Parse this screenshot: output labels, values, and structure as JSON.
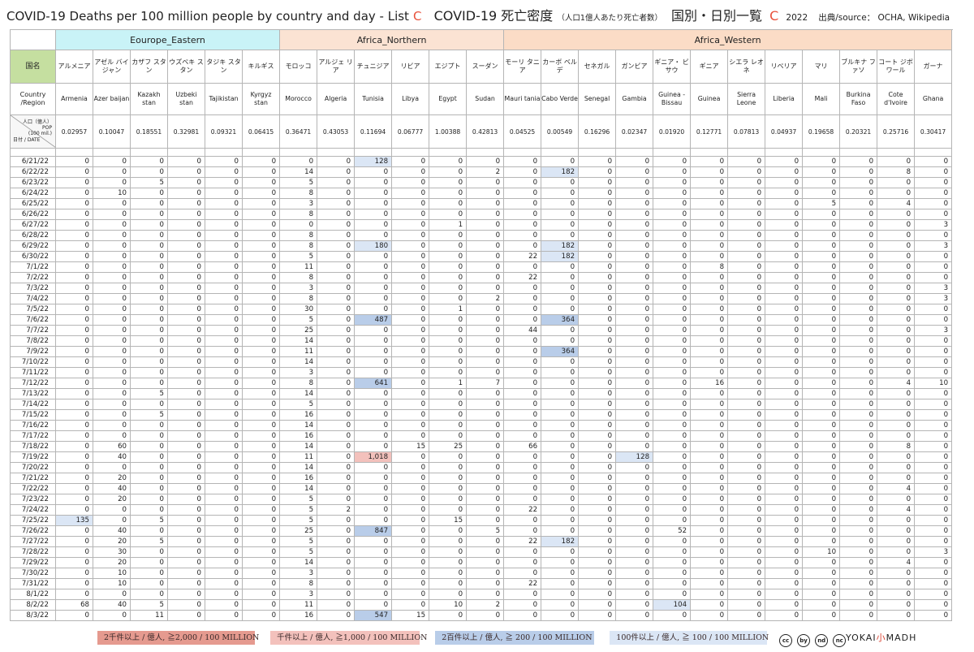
{
  "title": {
    "en": "COVID-19 Deaths per 100 million people by country and day - List",
    "en_letter": "C",
    "jp_main": "COVID-19 死亡密度",
    "jp_sub": "（人口1億人あたり死亡者数）",
    "jp_list": "国別・日別一覧",
    "jp_letter": "C",
    "year": "2022",
    "source": "出典/source： OCHA, Wikipedia"
  },
  "header_labels": {
    "jp": "国名",
    "en": "Country /Region",
    "pop_a": "人口（億人）",
    "pop_b": "POP",
    "pop_c": "(100 mil.)",
    "pop_date": "日付 / DATE"
  },
  "regions": [
    {
      "name": "Eourope_Eastern",
      "span": 6
    },
    {
      "name": "Africa_Northern",
      "span": 6
    },
    {
      "name": "Africa_Western",
      "span": 13
    }
  ],
  "countries": [
    {
      "jp": "アルメニア",
      "en": "Armenia",
      "pop": "0.02957"
    },
    {
      "jp": "アゼル バイジャン",
      "en": "Azer baijan",
      "pop": "0.10047"
    },
    {
      "jp": "カザフ スタン",
      "en": "Kazakh stan",
      "pop": "0.18551"
    },
    {
      "jp": "ウズベキ スタン",
      "en": "Uzbeki stan",
      "pop": "0.32981"
    },
    {
      "jp": "タジキ スタン",
      "en": "Tajikistan",
      "pop": "0.09321"
    },
    {
      "jp": "キルギス",
      "en": "Kyrgyz stan",
      "pop": "0.06415"
    },
    {
      "jp": "モロッコ",
      "en": "Morocco",
      "pop": "0.36471"
    },
    {
      "jp": "アルジェ リア",
      "en": "Algeria",
      "pop": "0.43053"
    },
    {
      "jp": "チュニジア",
      "en": "Tunisia",
      "pop": "0.11694"
    },
    {
      "jp": "リビア",
      "en": "Libya",
      "pop": "0.06777"
    },
    {
      "jp": "エジプト",
      "en": "Egypt",
      "pop": "1.00388"
    },
    {
      "jp": "スーダン",
      "en": "Sudan",
      "pop": "0.42813"
    },
    {
      "jp": "モーリ タニア",
      "en": "Mauri tania",
      "pop": "0.04525"
    },
    {
      "jp": "カーボ ベルデ",
      "en": "Cabo Verde",
      "pop": "0.00549"
    },
    {
      "jp": "セネガル",
      "en": "Senegal",
      "pop": "0.16296"
    },
    {
      "jp": "ガンビア",
      "en": "Gambia",
      "pop": "0.02347"
    },
    {
      "jp": "ギニア・ ビサウ",
      "en": "Guinea -Bissau",
      "pop": "0.01920"
    },
    {
      "jp": "ギニア",
      "en": "Guinea",
      "pop": "0.12771"
    },
    {
      "jp": "シエラ レオネ",
      "en": "Sierra Leone",
      "pop": "0.07813"
    },
    {
      "jp": "リベリア",
      "en": "Liberia",
      "pop": "0.04937"
    },
    {
      "jp": "マリ",
      "en": "Mali",
      "pop": "0.19658"
    },
    {
      "jp": "ブルキナ ファソ",
      "en": "Burkina Faso",
      "pop": "0.20321"
    },
    {
      "jp": "コート ジボワール",
      "en": "Cote d'Ivoire",
      "pop": "0.25716"
    },
    {
      "jp": "ガーナ",
      "en": "Ghana",
      "pop": "0.30417"
    }
  ],
  "rows": [
    {
      "date": "6/21/22",
      "v": [
        "0",
        "0",
        "0",
        "0",
        "0",
        "0",
        "0",
        "0",
        "128",
        "0",
        "0",
        "0",
        "0",
        "0",
        "0",
        "0",
        "0",
        "0",
        "0",
        "0",
        "0",
        "0",
        "0",
        "0"
      ]
    },
    {
      "date": "6/22/22",
      "v": [
        "0",
        "0",
        "0",
        "0",
        "0",
        "0",
        "14",
        "0",
        "0",
        "0",
        "0",
        "2",
        "0",
        "182",
        "0",
        "0",
        "0",
        "0",
        "0",
        "0",
        "0",
        "0",
        "8",
        "0"
      ]
    },
    {
      "date": "6/23/22",
      "v": [
        "0",
        "0",
        "5",
        "0",
        "0",
        "0",
        "5",
        "0",
        "0",
        "0",
        "0",
        "0",
        "0",
        "0",
        "0",
        "0",
        "0",
        "0",
        "0",
        "0",
        "0",
        "0",
        "0",
        "0"
      ]
    },
    {
      "date": "6/24/22",
      "v": [
        "0",
        "10",
        "0",
        "0",
        "0",
        "0",
        "8",
        "0",
        "0",
        "0",
        "0",
        "0",
        "0",
        "0",
        "0",
        "0",
        "0",
        "0",
        "0",
        "0",
        "0",
        "0",
        "0",
        "0"
      ]
    },
    {
      "date": "6/25/22",
      "v": [
        "0",
        "0",
        "0",
        "0",
        "0",
        "0",
        "3",
        "0",
        "0",
        "0",
        "0",
        "0",
        "0",
        "0",
        "0",
        "0",
        "0",
        "0",
        "0",
        "0",
        "5",
        "0",
        "4",
        "0"
      ]
    },
    {
      "date": "6/26/22",
      "v": [
        "0",
        "0",
        "0",
        "0",
        "0",
        "0",
        "8",
        "0",
        "0",
        "0",
        "0",
        "0",
        "0",
        "0",
        "0",
        "0",
        "0",
        "0",
        "0",
        "0",
        "0",
        "0",
        "0",
        "0"
      ]
    },
    {
      "date": "6/27/22",
      "v": [
        "0",
        "0",
        "0",
        "0",
        "0",
        "0",
        "0",
        "0",
        "0",
        "0",
        "1",
        "0",
        "0",
        "0",
        "0",
        "0",
        "0",
        "0",
        "0",
        "0",
        "0",
        "0",
        "0",
        "3"
      ]
    },
    {
      "date": "6/28/22",
      "v": [
        "0",
        "0",
        "0",
        "0",
        "0",
        "0",
        "8",
        "0",
        "0",
        "0",
        "0",
        "0",
        "0",
        "0",
        "0",
        "0",
        "0",
        "0",
        "0",
        "0",
        "0",
        "0",
        "0",
        "0"
      ]
    },
    {
      "date": "6/29/22",
      "v": [
        "0",
        "0",
        "0",
        "0",
        "0",
        "0",
        "8",
        "0",
        "180",
        "0",
        "0",
        "0",
        "0",
        "182",
        "0",
        "0",
        "0",
        "0",
        "0",
        "0",
        "0",
        "0",
        "0",
        "3"
      ]
    },
    {
      "date": "6/30/22",
      "v": [
        "0",
        "0",
        "0",
        "0",
        "0",
        "0",
        "5",
        "0",
        "0",
        "0",
        "0",
        "0",
        "22",
        "182",
        "0",
        "0",
        "0",
        "0",
        "0",
        "0",
        "0",
        "0",
        "0",
        "0"
      ]
    },
    {
      "date": "7/1/22",
      "v": [
        "0",
        "0",
        "0",
        "0",
        "0",
        "0",
        "11",
        "0",
        "0",
        "0",
        "0",
        "0",
        "0",
        "0",
        "0",
        "0",
        "0",
        "8",
        "0",
        "0",
        "0",
        "0",
        "0",
        "0"
      ]
    },
    {
      "date": "7/2/22",
      "v": [
        "0",
        "0",
        "0",
        "0",
        "0",
        "0",
        "8",
        "0",
        "0",
        "0",
        "0",
        "0",
        "22",
        "0",
        "0",
        "0",
        "0",
        "0",
        "0",
        "0",
        "0",
        "0",
        "0",
        "0"
      ]
    },
    {
      "date": "7/3/22",
      "v": [
        "0",
        "0",
        "0",
        "0",
        "0",
        "0",
        "3",
        "0",
        "0",
        "0",
        "0",
        "0",
        "0",
        "0",
        "0",
        "0",
        "0",
        "0",
        "0",
        "0",
        "0",
        "0",
        "0",
        "3"
      ]
    },
    {
      "date": "7/4/22",
      "v": [
        "0",
        "0",
        "0",
        "0",
        "0",
        "0",
        "8",
        "0",
        "0",
        "0",
        "0",
        "2",
        "0",
        "0",
        "0",
        "0",
        "0",
        "0",
        "0",
        "0",
        "0",
        "0",
        "0",
        "3"
      ]
    },
    {
      "date": "7/5/22",
      "v": [
        "0",
        "0",
        "0",
        "0",
        "0",
        "0",
        "30",
        "0",
        "0",
        "0",
        "1",
        "0",
        "0",
        "0",
        "0",
        "0",
        "0",
        "0",
        "0",
        "0",
        "0",
        "0",
        "0",
        "0"
      ]
    },
    {
      "date": "7/6/22",
      "v": [
        "0",
        "0",
        "0",
        "0",
        "0",
        "0",
        "5",
        "0",
        "487",
        "0",
        "0",
        "0",
        "0",
        "364",
        "0",
        "0",
        "0",
        "0",
        "0",
        "0",
        "0",
        "0",
        "0",
        "0"
      ]
    },
    {
      "date": "7/7/22",
      "v": [
        "0",
        "0",
        "0",
        "0",
        "0",
        "0",
        "25",
        "0",
        "0",
        "0",
        "0",
        "0",
        "44",
        "0",
        "0",
        "0",
        "0",
        "0",
        "0",
        "0",
        "0",
        "0",
        "0",
        "3"
      ]
    },
    {
      "date": "7/8/22",
      "v": [
        "0",
        "0",
        "0",
        "0",
        "0",
        "0",
        "14",
        "0",
        "0",
        "0",
        "0",
        "0",
        "0",
        "0",
        "0",
        "0",
        "0",
        "0",
        "0",
        "0",
        "0",
        "0",
        "0",
        "0"
      ]
    },
    {
      "date": "7/9/22",
      "v": [
        "0",
        "0",
        "0",
        "0",
        "0",
        "0",
        "11",
        "0",
        "0",
        "0",
        "0",
        "0",
        "0",
        "364",
        "0",
        "0",
        "0",
        "0",
        "0",
        "0",
        "0",
        "0",
        "0",
        "0"
      ]
    },
    {
      "date": "7/10/22",
      "v": [
        "0",
        "0",
        "0",
        "0",
        "0",
        "0",
        "14",
        "0",
        "0",
        "0",
        "0",
        "0",
        "0",
        "0",
        "0",
        "0",
        "0",
        "0",
        "0",
        "0",
        "0",
        "0",
        "0",
        "0"
      ]
    },
    {
      "date": "7/11/22",
      "v": [
        "0",
        "0",
        "0",
        "0",
        "0",
        "0",
        "3",
        "0",
        "0",
        "0",
        "0",
        "0",
        "0",
        "0",
        "0",
        "0",
        "0",
        "0",
        "0",
        "0",
        "0",
        "0",
        "0",
        "0"
      ]
    },
    {
      "date": "7/12/22",
      "v": [
        "0",
        "0",
        "0",
        "0",
        "0",
        "0",
        "8",
        "0",
        "641",
        "0",
        "1",
        "7",
        "0",
        "0",
        "0",
        "0",
        "0",
        "16",
        "0",
        "0",
        "0",
        "0",
        "4",
        "10"
      ]
    },
    {
      "date": "7/13/22",
      "v": [
        "0",
        "0",
        "5",
        "0",
        "0",
        "0",
        "14",
        "0",
        "0",
        "0",
        "0",
        "0",
        "0",
        "0",
        "0",
        "0",
        "0",
        "0",
        "0",
        "0",
        "0",
        "0",
        "0",
        "0"
      ]
    },
    {
      "date": "7/14/22",
      "v": [
        "0",
        "0",
        "0",
        "0",
        "0",
        "0",
        "5",
        "0",
        "0",
        "0",
        "0",
        "0",
        "0",
        "0",
        "0",
        "0",
        "0",
        "0",
        "0",
        "0",
        "0",
        "0",
        "0",
        "0"
      ]
    },
    {
      "date": "7/15/22",
      "v": [
        "0",
        "0",
        "5",
        "0",
        "0",
        "0",
        "16",
        "0",
        "0",
        "0",
        "0",
        "0",
        "0",
        "0",
        "0",
        "0",
        "0",
        "0",
        "0",
        "0",
        "0",
        "0",
        "0",
        "0"
      ]
    },
    {
      "date": "7/16/22",
      "v": [
        "0",
        "0",
        "0",
        "0",
        "0",
        "0",
        "14",
        "0",
        "0",
        "0",
        "0",
        "0",
        "0",
        "0",
        "0",
        "0",
        "0",
        "0",
        "0",
        "0",
        "0",
        "0",
        "0",
        "0"
      ]
    },
    {
      "date": "7/17/22",
      "v": [
        "0",
        "0",
        "0",
        "0",
        "0",
        "0",
        "16",
        "0",
        "0",
        "0",
        "0",
        "0",
        "0",
        "0",
        "0",
        "0",
        "0",
        "0",
        "0",
        "0",
        "0",
        "0",
        "0",
        "0"
      ]
    },
    {
      "date": "7/18/22",
      "v": [
        "0",
        "60",
        "0",
        "0",
        "0",
        "0",
        "14",
        "0",
        "0",
        "15",
        "25",
        "0",
        "66",
        "0",
        "0",
        "0",
        "0",
        "0",
        "0",
        "0",
        "0",
        "0",
        "8",
        "0"
      ]
    },
    {
      "date": "7/19/22",
      "v": [
        "0",
        "40",
        "0",
        "0",
        "0",
        "0",
        "11",
        "0",
        "1,018",
        "0",
        "0",
        "0",
        "0",
        "0",
        "0",
        "128",
        "0",
        "0",
        "0",
        "0",
        "0",
        "0",
        "0",
        "0"
      ]
    },
    {
      "date": "7/20/22",
      "v": [
        "0",
        "0",
        "0",
        "0",
        "0",
        "0",
        "14",
        "0",
        "0",
        "0",
        "0",
        "0",
        "0",
        "0",
        "0",
        "0",
        "0",
        "0",
        "0",
        "0",
        "0",
        "0",
        "0",
        "0"
      ]
    },
    {
      "date": "7/21/22",
      "v": [
        "0",
        "20",
        "0",
        "0",
        "0",
        "0",
        "16",
        "0",
        "0",
        "0",
        "0",
        "0",
        "0",
        "0",
        "0",
        "0",
        "0",
        "0",
        "0",
        "0",
        "0",
        "0",
        "0",
        "0"
      ]
    },
    {
      "date": "7/22/22",
      "v": [
        "0",
        "40",
        "0",
        "0",
        "0",
        "0",
        "14",
        "0",
        "0",
        "0",
        "0",
        "0",
        "0",
        "0",
        "0",
        "0",
        "0",
        "0",
        "0",
        "0",
        "0",
        "0",
        "4",
        "0"
      ]
    },
    {
      "date": "7/23/22",
      "v": [
        "0",
        "20",
        "0",
        "0",
        "0",
        "0",
        "5",
        "0",
        "0",
        "0",
        "0",
        "0",
        "0",
        "0",
        "0",
        "0",
        "0",
        "0",
        "0",
        "0",
        "0",
        "0",
        "0",
        "0"
      ]
    },
    {
      "date": "7/24/22",
      "v": [
        "0",
        "0",
        "0",
        "0",
        "0",
        "0",
        "5",
        "2",
        "0",
        "0",
        "0",
        "0",
        "22",
        "0",
        "0",
        "0",
        "0",
        "0",
        "0",
        "0",
        "0",
        "0",
        "4",
        "0"
      ]
    },
    {
      "date": "7/25/22",
      "v": [
        "135",
        "0",
        "5",
        "0",
        "0",
        "0",
        "5",
        "0",
        "0",
        "0",
        "15",
        "0",
        "0",
        "0",
        "0",
        "0",
        "0",
        "0",
        "0",
        "0",
        "0",
        "0",
        "0",
        "0"
      ]
    },
    {
      "date": "7/26/22",
      "v": [
        "0",
        "40",
        "0",
        "0",
        "0",
        "0",
        "25",
        "0",
        "847",
        "0",
        "0",
        "5",
        "0",
        "0",
        "0",
        "0",
        "52",
        "0",
        "0",
        "0",
        "0",
        "0",
        "0",
        "0"
      ]
    },
    {
      "date": "7/27/22",
      "v": [
        "0",
        "20",
        "5",
        "0",
        "0",
        "0",
        "5",
        "0",
        "0",
        "0",
        "0",
        "0",
        "22",
        "182",
        "0",
        "0",
        "0",
        "0",
        "0",
        "0",
        "0",
        "0",
        "0",
        "0"
      ]
    },
    {
      "date": "7/28/22",
      "v": [
        "0",
        "30",
        "0",
        "0",
        "0",
        "0",
        "5",
        "0",
        "0",
        "0",
        "0",
        "0",
        "0",
        "0",
        "0",
        "0",
        "0",
        "0",
        "0",
        "0",
        "10",
        "0",
        "0",
        "3"
      ]
    },
    {
      "date": "7/29/22",
      "v": [
        "0",
        "20",
        "0",
        "0",
        "0",
        "0",
        "14",
        "0",
        "0",
        "0",
        "0",
        "0",
        "0",
        "0",
        "0",
        "0",
        "0",
        "0",
        "0",
        "0",
        "0",
        "0",
        "4",
        "0"
      ]
    },
    {
      "date": "7/30/22",
      "v": [
        "0",
        "10",
        "0",
        "0",
        "0",
        "0",
        "3",
        "0",
        "0",
        "0",
        "0",
        "0",
        "0",
        "0",
        "0",
        "0",
        "0",
        "0",
        "0",
        "0",
        "0",
        "0",
        "0",
        "0"
      ]
    },
    {
      "date": "7/31/22",
      "v": [
        "0",
        "10",
        "0",
        "0",
        "0",
        "0",
        "8",
        "0",
        "0",
        "0",
        "0",
        "0",
        "22",
        "0",
        "0",
        "0",
        "0",
        "0",
        "0",
        "0",
        "0",
        "0",
        "0",
        "0"
      ]
    },
    {
      "date": "8/1/22",
      "v": [
        "0",
        "0",
        "0",
        "0",
        "0",
        "0",
        "3",
        "0",
        "0",
        "0",
        "0",
        "0",
        "0",
        "0",
        "0",
        "0",
        "0",
        "0",
        "0",
        "0",
        "0",
        "0",
        "0",
        "0"
      ]
    },
    {
      "date": "8/2/22",
      "v": [
        "68",
        "40",
        "5",
        "0",
        "0",
        "0",
        "11",
        "0",
        "0",
        "0",
        "10",
        "2",
        "0",
        "0",
        "0",
        "0",
        "104",
        "0",
        "0",
        "0",
        "0",
        "0",
        "0",
        "0"
      ]
    },
    {
      "date": "8/3/22",
      "v": [
        "0",
        "0",
        "11",
        "0",
        "0",
        "0",
        "16",
        "0",
        "547",
        "15",
        "0",
        "0",
        "0",
        "0",
        "0",
        "0",
        "0",
        "0",
        "0",
        "0",
        "0",
        "0",
        "0",
        "0"
      ]
    }
  ],
  "highlight_colors": {
    "over_100": "#dbe6f5",
    "over_200": "#b9cde9",
    "over_1000": "#f3c1bc",
    "over_2000": "#e59a8f"
  },
  "legend": [
    "2千件以上 / 億人, ≧2,000 / 100 MILLION",
    "千件以上 / 億人, ≧1,000 / 100 MILLION",
    "2百件以上 / 億人, ≧ 200 / 100 MILLION",
    "100件以上 / 億人, ≧ 100 / 100 MILLION"
  ],
  "license_icons": [
    "cc",
    "by",
    "nd",
    "nc"
  ],
  "brand": {
    "left": "YOKAI",
    "mid": "小",
    "right": "MADH"
  }
}
